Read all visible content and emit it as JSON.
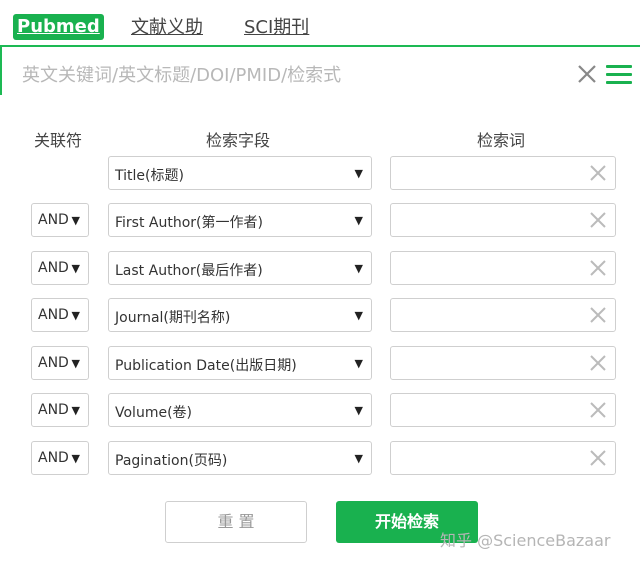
{
  "tabs": [
    {
      "label": "Pubmed",
      "active": true
    },
    {
      "label": "文献义助",
      "active": false
    },
    {
      "label": "SCI期刊",
      "active": false
    }
  ],
  "search": {
    "placeholder": "英文关键词/英文标题/DOI/PMID/检索式"
  },
  "headers": {
    "operator": "关联符",
    "field": "检索字段",
    "term": "检索词"
  },
  "rows": [
    {
      "operator": "",
      "field": "Title(标题)"
    },
    {
      "operator": "AND",
      "field": "First Author(第一作者)"
    },
    {
      "operator": "AND",
      "field": "Last Author(最后作者)"
    },
    {
      "operator": "AND",
      "field": "Journal(期刊名称)"
    },
    {
      "operator": "AND",
      "field": "Publication Date(出版日期)"
    },
    {
      "operator": "AND",
      "field": "Volume(卷)"
    },
    {
      "operator": "AND",
      "field": "Pagination(页码)"
    }
  ],
  "buttons": {
    "reset": "重 置",
    "search": "开始检索"
  },
  "watermark": "知乎 @ScienceBazaar",
  "colors": {
    "accent": "#19b14f",
    "border": "#cfcfcf"
  }
}
